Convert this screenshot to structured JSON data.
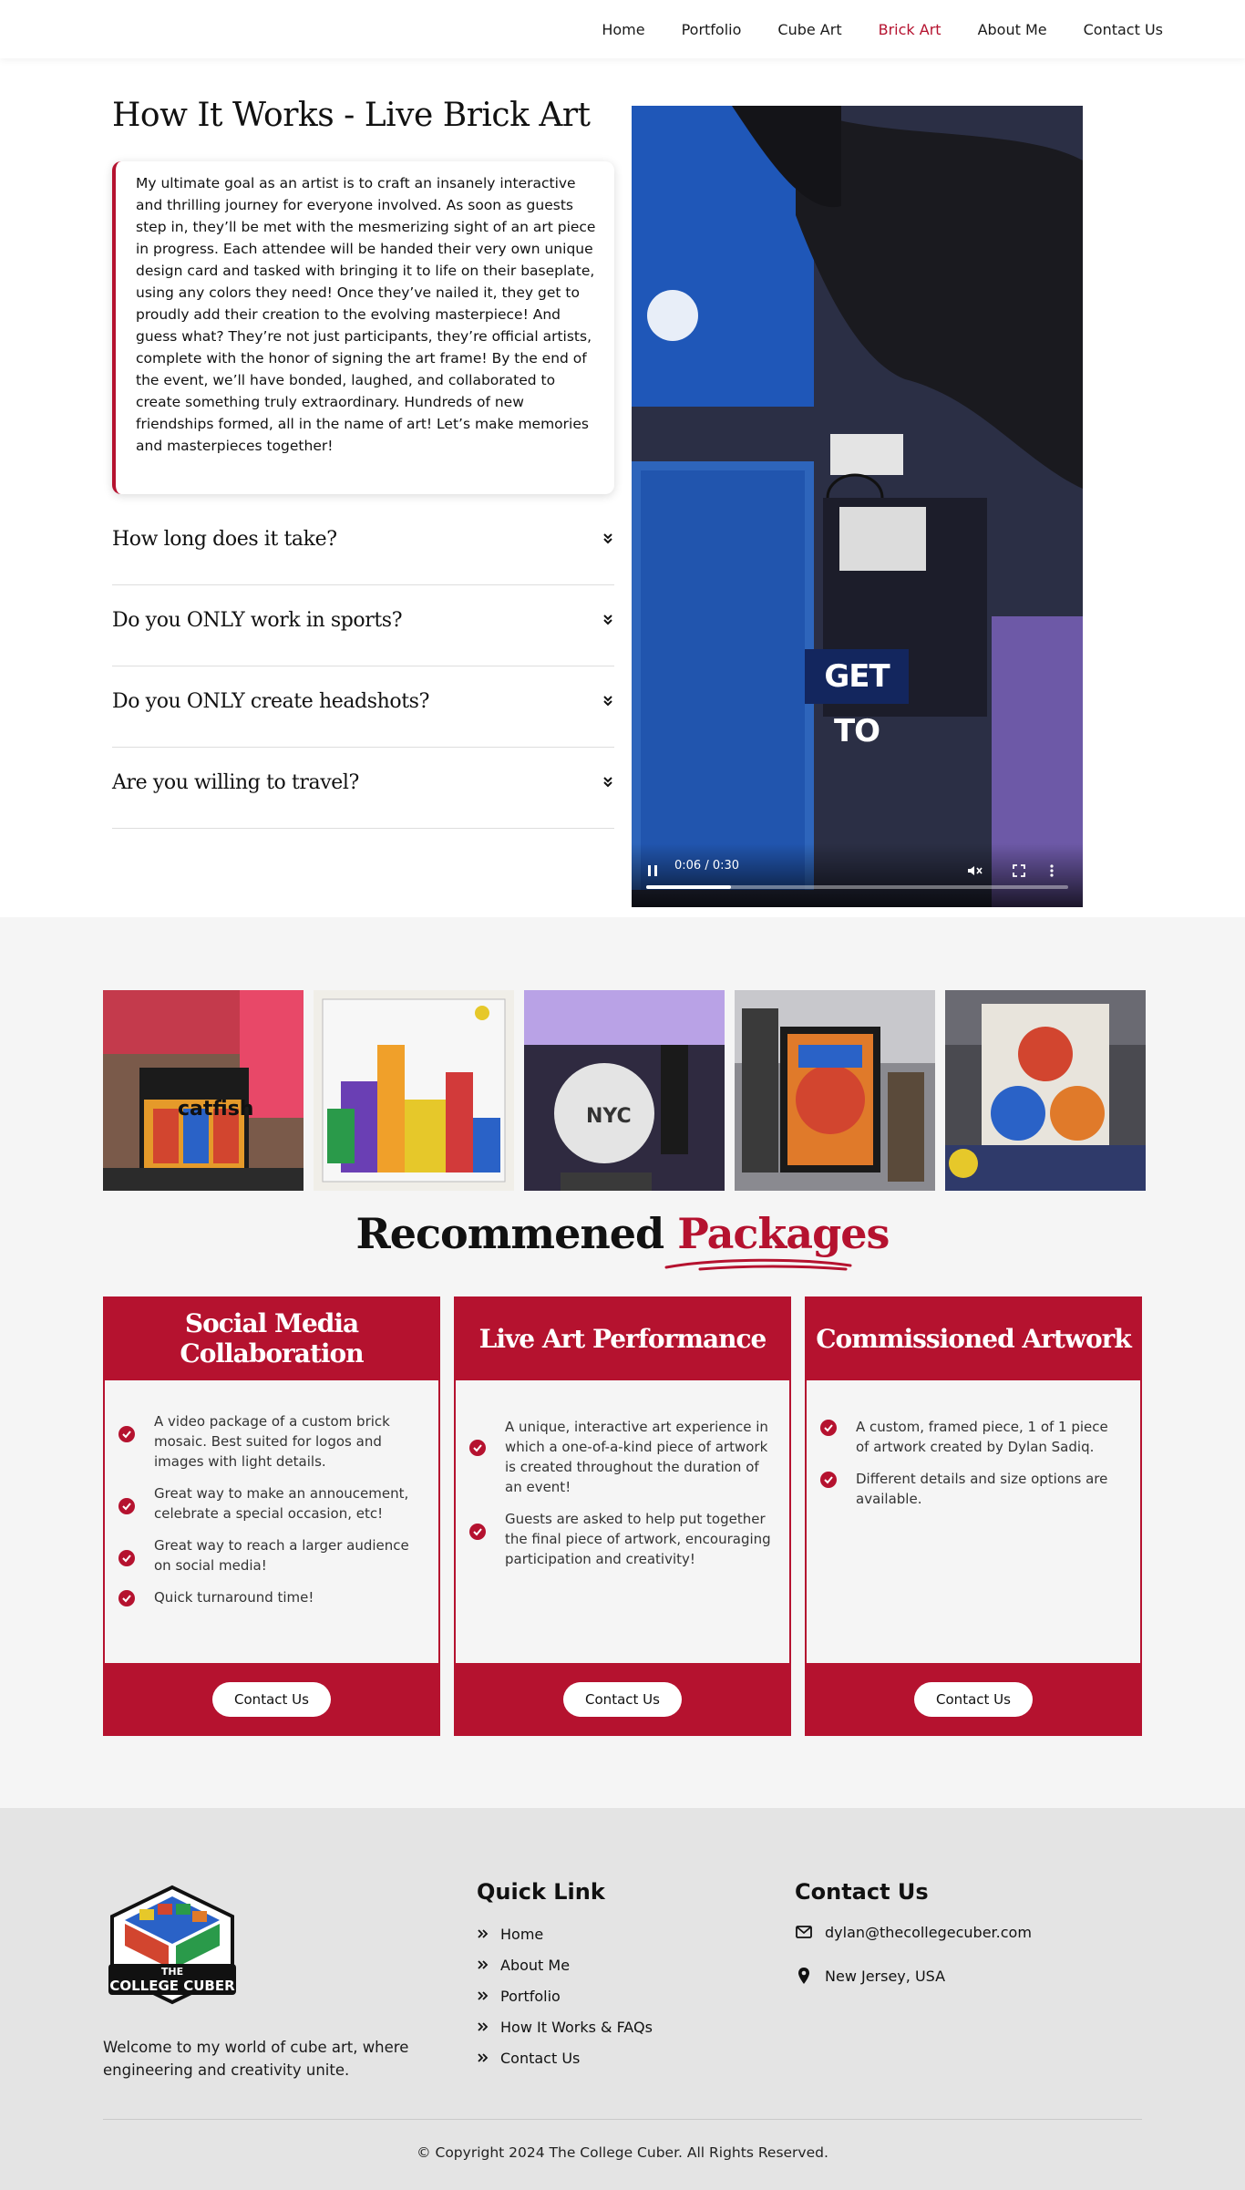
{
  "nav": {
    "items": [
      {
        "label": "Home"
      },
      {
        "label": "Portfolio"
      },
      {
        "label": "Cube Art"
      },
      {
        "label": "Brick Art"
      },
      {
        "label": "About Me"
      },
      {
        "label": "Contact Us"
      }
    ],
    "active": "Brick Art"
  },
  "how_it_works": {
    "title": "How It Works - Live Brick Art",
    "body": "My ultimate goal as an artist is to craft an insanely interactive and thrilling journey for everyone involved. As soon as guests step in, they’ll be met with the mesmerizing sight of an art piece in progress. Each attendee will be handed their very own unique design card and tasked with bringing it to life on their baseplate, using any colors they need! Once they’ve nailed it, they get to proudly add their creation to the evolving masterpiece! And guess what? They’re not just participants, they’re official artists, complete with the honor of signing the art frame! By the end of the event, we’ll have bonded, laughed, and collaborated to create something truly extraordinary. Hundreds of new friendships formed, all in the name of art! Let’s make memories and masterpieces together!",
    "faqs": [
      {
        "question": "How long does it take?"
      },
      {
        "question": "Do you ONLY work in sports?"
      },
      {
        "question": "Do you ONLY create headshots?"
      },
      {
        "question": "Are you willing to travel?"
      }
    ]
  },
  "video": {
    "time": "0:06 / 0:30",
    "progress": 0.2,
    "overlay_text": "GET TO"
  },
  "gallery": {
    "tiles": [
      {
        "caption": "catfish"
      },
      {
        "caption": ""
      },
      {
        "caption": "NYC"
      },
      {
        "caption": ""
      },
      {
        "caption": ""
      }
    ]
  },
  "packages": {
    "heading_main": "Recommened",
    "heading_highlight": "Packages",
    "cards": [
      {
        "title": "Social Media Collaboration",
        "bullets": [
          "A video package of a custom brick mosaic. Best suited for logos and images with light details.",
          "Great way to make an annoucement, celebrate a special occasion, etc!",
          "Great way to reach a larger audience on social media!",
          "Quick turnaround time!"
        ],
        "button": "Contact Us"
      },
      {
        "title": "Live Art Performance",
        "bullets": [
          "A unique, interactive art experience in which a one-of-a-kind piece of artwork is created throughout the duration of an event!",
          "Guests are asked to help put together the final piece of artwork, encouraging participation and creativity!"
        ],
        "button": "Contact Us"
      },
      {
        "title": "Commissioned Artwork",
        "bullets": [
          "A custom, framed piece, 1 of 1 piece of artwork created by Dylan Sadiq.",
          "Different details and size options are available."
        ],
        "button": "Contact Us"
      }
    ]
  },
  "footer": {
    "logo_text_1": "THE",
    "logo_text_2": "COLLEGE CUBER",
    "welcome": "Welcome to my world of cube art, where engineering and creativity unite.",
    "quick_link_title": "Quick Link",
    "quick_links": [
      {
        "label": "Home"
      },
      {
        "label": "About Me"
      },
      {
        "label": "Portfolio"
      },
      {
        "label": "How It Works & FAQs"
      },
      {
        "label": "Contact Us"
      }
    ],
    "contact_title": "Contact Us",
    "email": "dylan@thecollegecuber.com",
    "location": "New Jersey, USA",
    "copyright": "© Copyright 2024 The College Cuber. All Rights Reserved."
  },
  "colors": {
    "accent": "#b5122f",
    "section_bg": "#f5f5f5",
    "footer_bg": "#e4e4e4"
  }
}
